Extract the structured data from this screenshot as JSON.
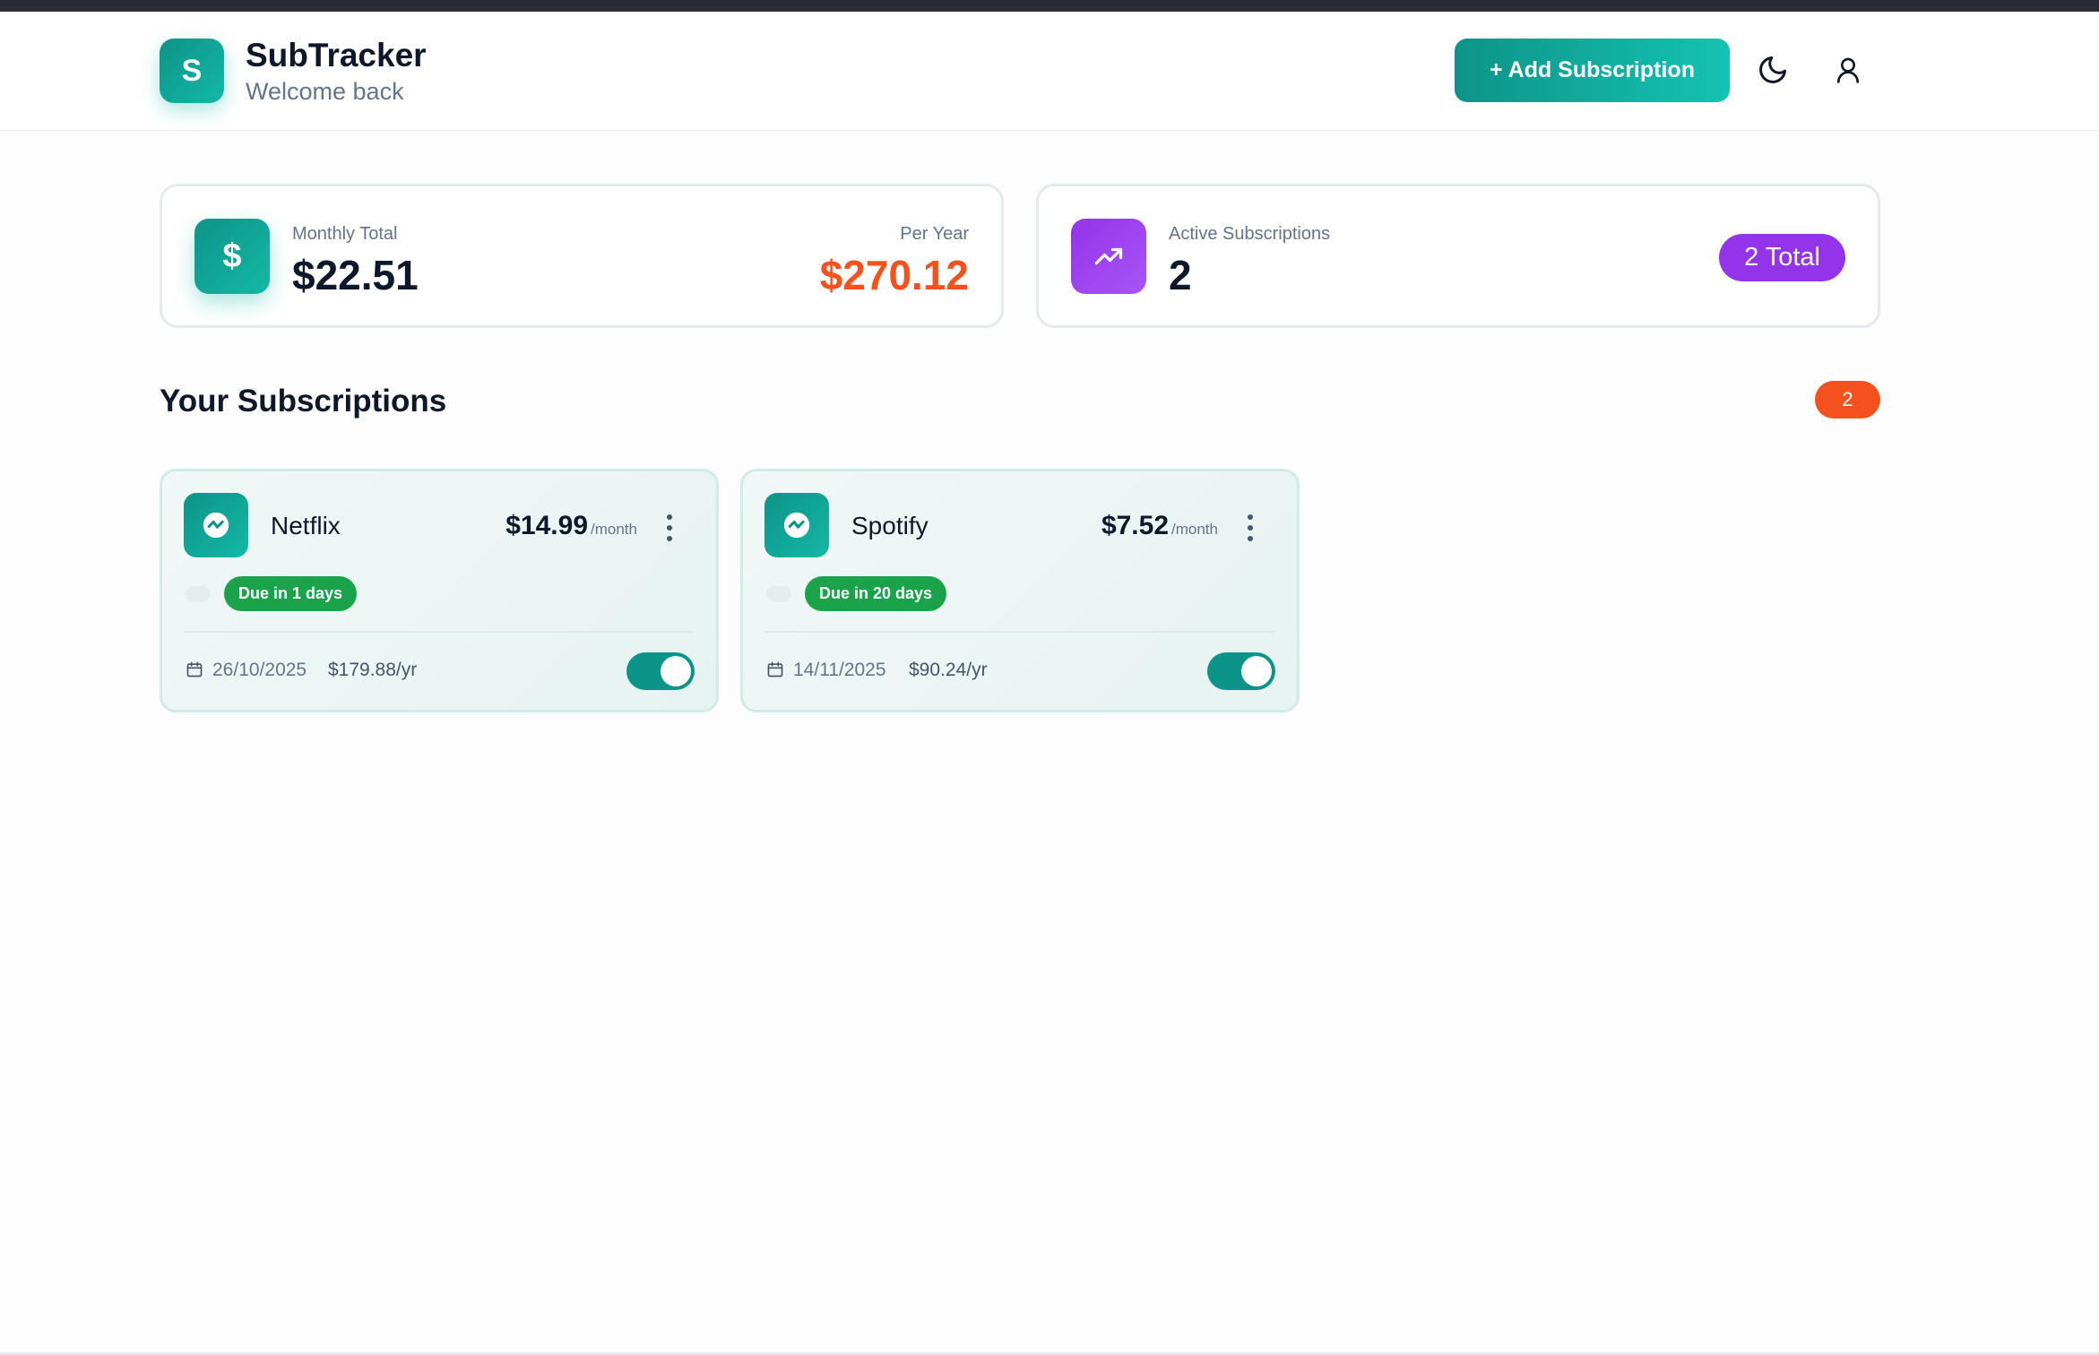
{
  "header": {
    "logo_letter": "S",
    "title": "SubTracker",
    "subtitle": "Welcome back",
    "add_button_label": "+ Add Subscription",
    "theme_icon": "moon-icon",
    "user_icon": "user-icon"
  },
  "stats": {
    "monthly": {
      "icon": "dollar-icon",
      "icon_glyph": "$",
      "label": "Monthly Total",
      "value": "$22.51",
      "year_label": "Per Year",
      "year_value": "$270.12"
    },
    "active": {
      "icon": "trending-up-icon",
      "label": "Active Subscriptions",
      "value": "2",
      "badge": "2 Total"
    }
  },
  "section": {
    "title": "Your Subscriptions",
    "count": "2"
  },
  "subscriptions": [
    {
      "name": "Netflix",
      "price": "$14.99",
      "period": "/month",
      "due": "Due in 1 days",
      "date": "26/10/2025",
      "yearly": "$179.88/yr",
      "active": true
    },
    {
      "name": "Spotify",
      "price": "$7.52",
      "period": "/month",
      "due": "Due in 20 days",
      "date": "14/11/2025",
      "yearly": "$90.24/yr",
      "active": true
    }
  ],
  "colors": {
    "accent": "#0d9488",
    "orange": "#f4511e",
    "purple": "#9333ea",
    "due_green": "#1aa34a"
  }
}
